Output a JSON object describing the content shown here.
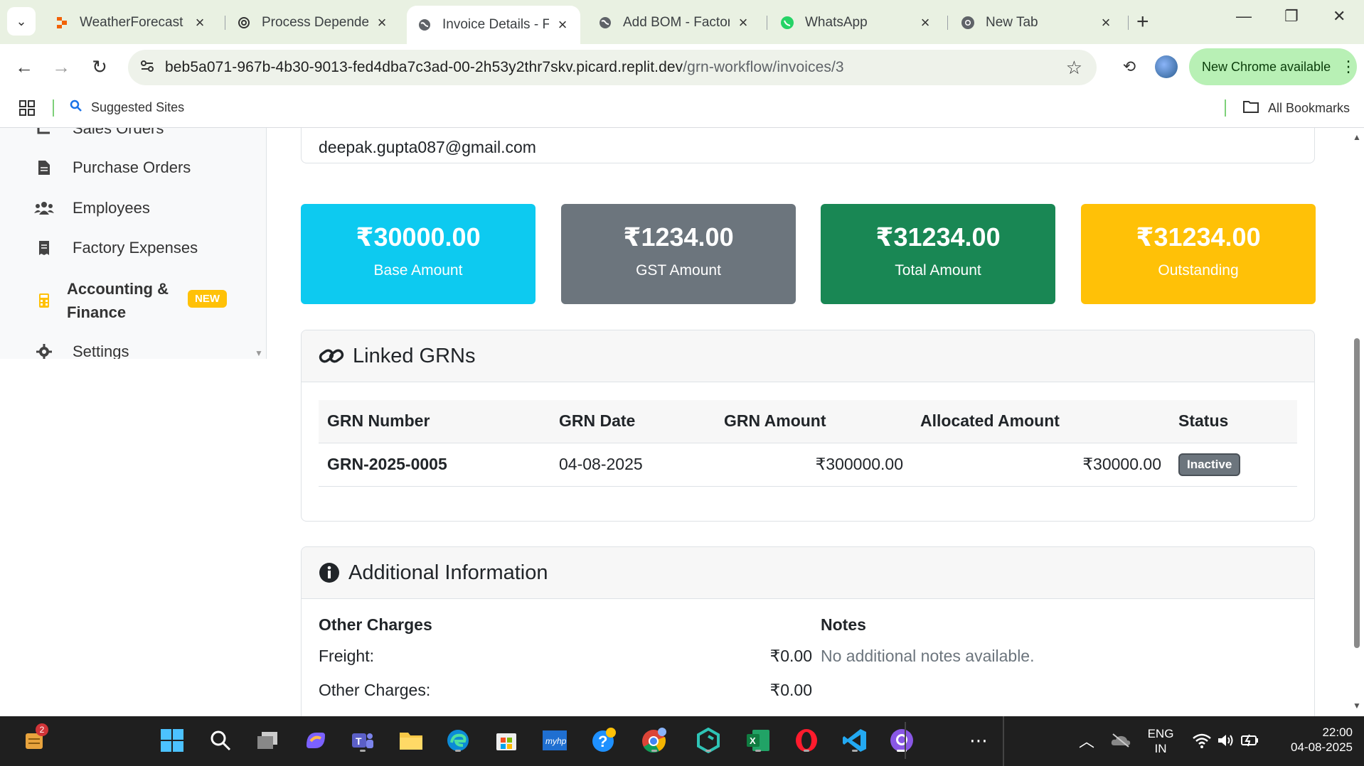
{
  "browser": {
    "tabs": [
      {
        "title": "WeatherForecast -",
        "icon": "replit-icon",
        "active": false
      },
      {
        "title": "Process Dependen",
        "icon": "openai-icon",
        "active": false
      },
      {
        "title": "Invoice Details - Fa",
        "icon": "globe-icon",
        "active": true
      },
      {
        "title": "Add BOM - Factory",
        "icon": "globe-icon",
        "active": false
      },
      {
        "title": "WhatsApp",
        "icon": "whatsapp-icon",
        "active": false
      },
      {
        "title": "New Tab",
        "icon": "chrome-icon",
        "active": false
      }
    ],
    "url_host": "beb5a071-967b-4b30-9013-fed4dba7c3ad-00-2h53y2thr7skv.picard.replit.dev",
    "url_path": "/grn-workflow/invoices/3",
    "update_label": "New Chrome available",
    "bookmarks": {
      "suggested": "Suggested Sites",
      "all": "All Bookmarks"
    }
  },
  "sidebar": {
    "items": [
      {
        "label": "Sales Orders",
        "icon": "sales-orders-icon"
      },
      {
        "label": "Purchase Orders",
        "icon": "file-icon"
      },
      {
        "label": "Employees",
        "icon": "users-icon"
      },
      {
        "label": "Factory Expenses",
        "icon": "receipt-icon"
      },
      {
        "label": "Accounting &",
        "label2": "Finance",
        "icon": "calculator-icon"
      },
      {
        "label": "Settings",
        "icon": "gear-icon"
      }
    ],
    "new_badge": "NEW"
  },
  "vendor": {
    "email": "deepak.gupta087@gmail.com"
  },
  "stats": [
    {
      "value": "₹30000.00",
      "label": "Base Amount",
      "color": "#0dcaf0"
    },
    {
      "value": "₹1234.00",
      "label": "GST Amount",
      "color": "#6c757d"
    },
    {
      "value": "₹31234.00",
      "label": "Total Amount",
      "color": "#198754"
    },
    {
      "value": "₹31234.00",
      "label": "Outstanding",
      "color": "#ffc107"
    }
  ],
  "linked_grns": {
    "title": "Linked GRNs",
    "columns": [
      "GRN Number",
      "GRN Date",
      "GRN Amount",
      "Allocated Amount",
      "Status"
    ],
    "rows": [
      {
        "number": "GRN-2025-0005",
        "date": "04-08-2025",
        "amount": "₹300000.00",
        "allocated": "₹30000.00",
        "status": "Inactive"
      }
    ]
  },
  "additional": {
    "title": "Additional Information",
    "other_charges_heading": "Other Charges",
    "freight_label": "Freight:",
    "freight_value": "₹0.00",
    "other_label": "Other Charges:",
    "other_value": "₹0.00",
    "notes_heading": "Notes",
    "notes_text": "No additional notes available."
  },
  "taskbar": {
    "notification_count": "2",
    "lang_line1": "ENG",
    "lang_line2": "IN",
    "time": "22:00",
    "date": "04-08-2025"
  }
}
